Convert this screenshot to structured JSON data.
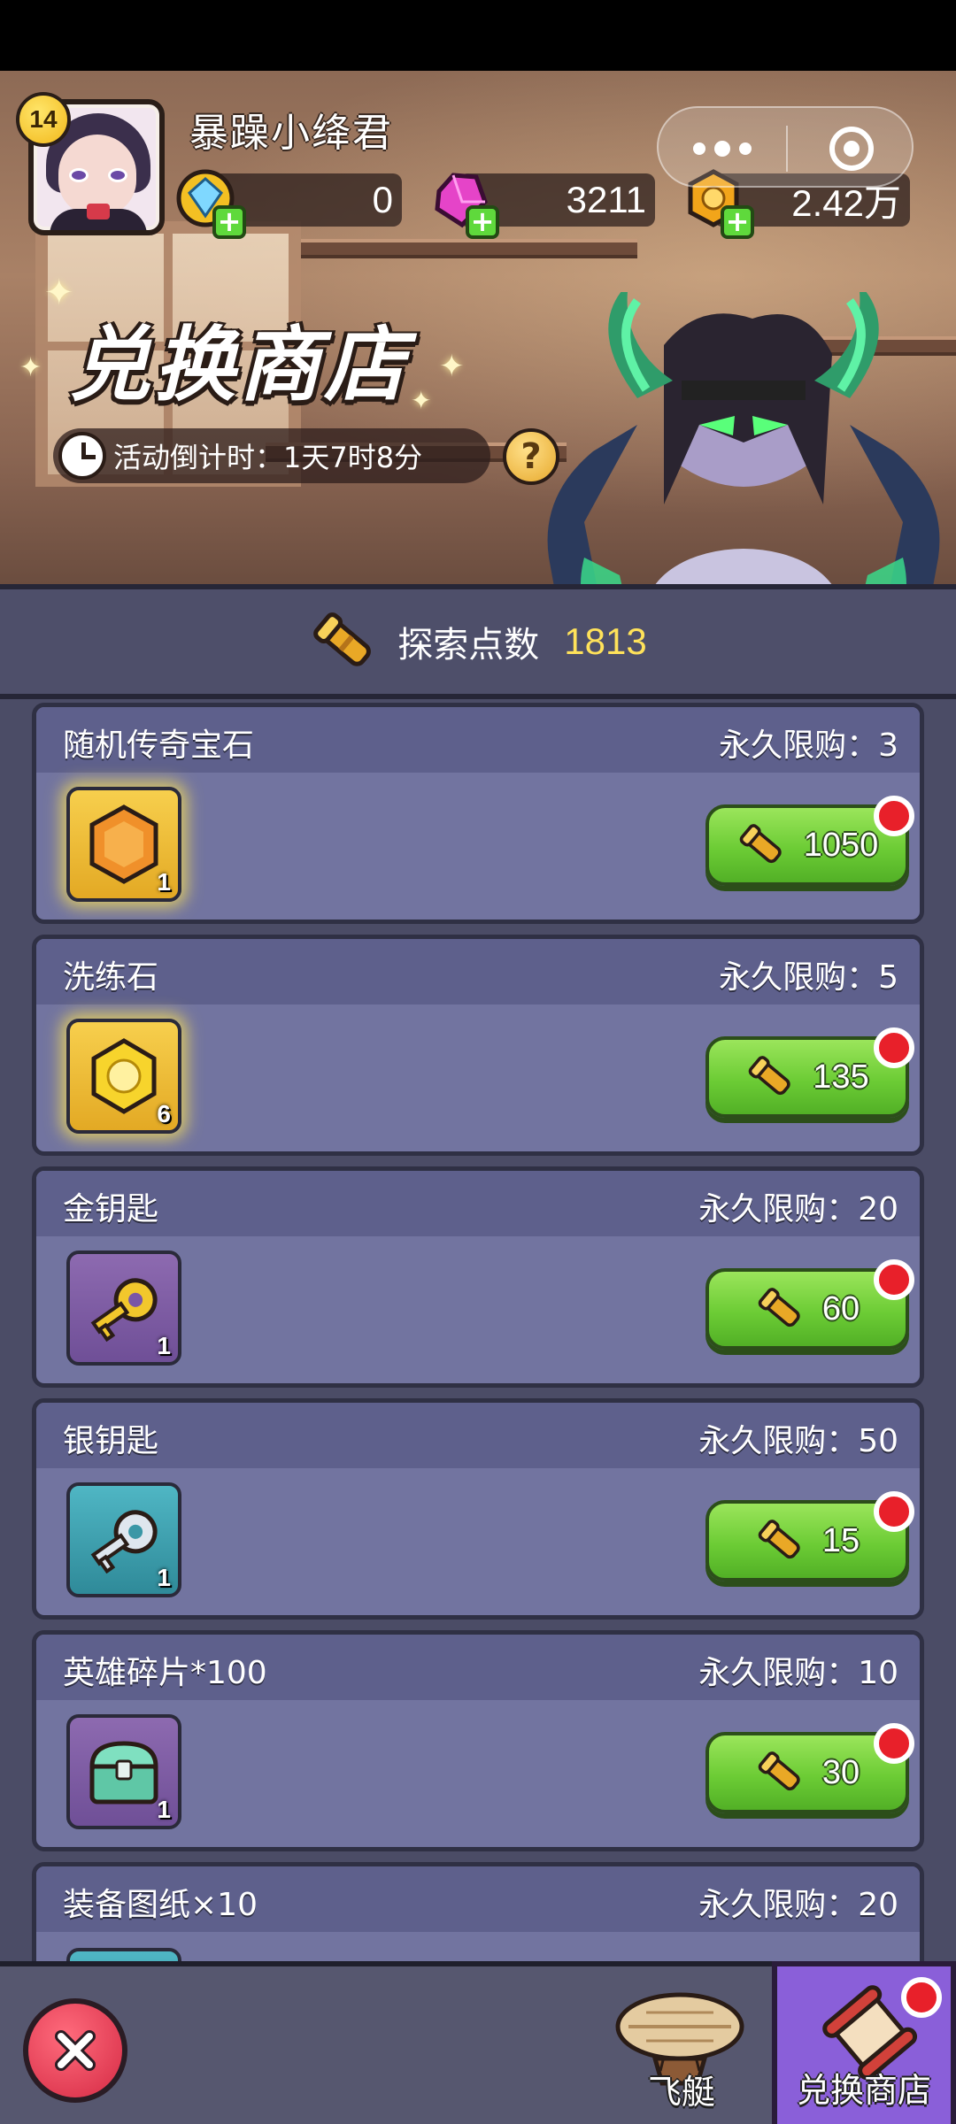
{
  "header": {
    "level": "14",
    "player_name": "暴躁小绛君",
    "currencies": [
      {
        "icon": "blue-gem-coin-icon",
        "value": "0"
      },
      {
        "icon": "pink-crystal-icon",
        "value": "3211"
      },
      {
        "icon": "gold-coin-icon",
        "value": "2.42万"
      }
    ]
  },
  "banner": {
    "title": "兑换商店",
    "countdown": "活动倒计时：1天7时8分",
    "help": "?"
  },
  "points": {
    "label": "探索点数",
    "value": "1813"
  },
  "items": [
    {
      "name": "随机传奇宝石",
      "limit": "永久限购：3",
      "count": "1",
      "price": "1050",
      "icon": "orange-gem-icon",
      "slot": "gold"
    },
    {
      "name": "洗练石",
      "limit": "永久限购：5",
      "count": "6",
      "price": "135",
      "icon": "yellow-stone-icon",
      "slot": "gold"
    },
    {
      "name": "金钥匙",
      "limit": "永久限购：20",
      "count": "1",
      "price": "60",
      "icon": "gold-key-icon",
      "slot": "purple"
    },
    {
      "name": "银钥匙",
      "limit": "永久限购：50",
      "count": "1",
      "price": "15",
      "icon": "silver-key-icon",
      "slot": "teal"
    },
    {
      "name": "英雄碎片*100",
      "limit": "永久限购：10",
      "count": "1",
      "price": "30",
      "icon": "hero-chest-icon",
      "slot": "purple"
    },
    {
      "name": "装备图纸×10",
      "limit": "永久限购：20",
      "count": "",
      "price": "",
      "icon": "blueprint-icon",
      "slot": "teal"
    }
  ],
  "nav": {
    "airship_label": "飞艇",
    "shop_label": "兑换商店"
  },
  "colors": {
    "buy_green": "#6ccc35",
    "badge_red": "#e8202a",
    "points_yellow": "#ffe25a",
    "card_bg": "#7274a0"
  }
}
